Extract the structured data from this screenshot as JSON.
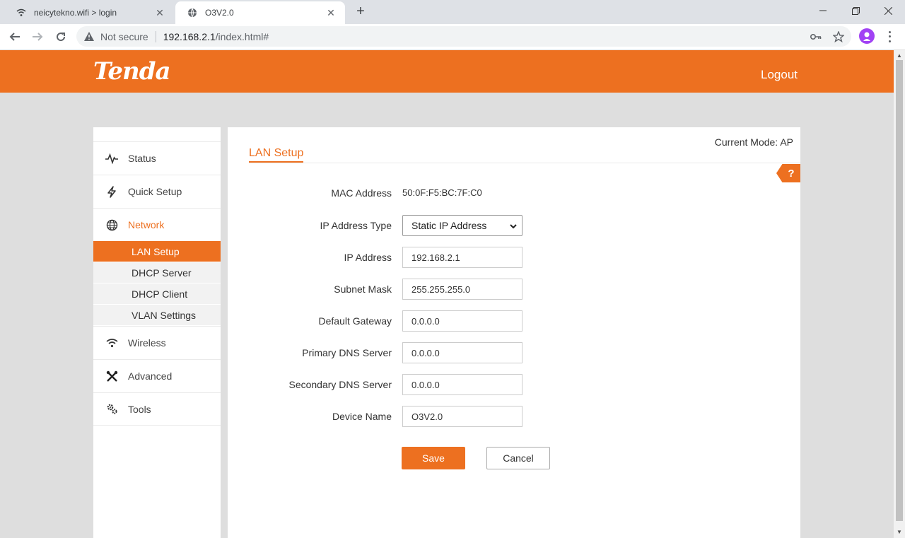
{
  "browser": {
    "tabs": [
      {
        "title": "neicytekno.wifi > login",
        "favicon": "wifi-icon"
      },
      {
        "title": "O3V2.0",
        "favicon": "globe-icon"
      }
    ],
    "new_tab": "+",
    "not_secure": "Not secure",
    "url_host": "192.168.2.1",
    "url_path": "/index.html#"
  },
  "header": {
    "logo": "Tenda",
    "logout": "Logout",
    "brand_color": "#ed7020"
  },
  "sidebar": {
    "items": [
      {
        "label": "Status",
        "icon": "pulse-icon"
      },
      {
        "label": "Quick Setup",
        "icon": "bolt-icon"
      },
      {
        "label": "Network",
        "icon": "globe-icon"
      },
      {
        "label": "Wireless",
        "icon": "wifi-icon"
      },
      {
        "label": "Advanced",
        "icon": "tools-icon"
      },
      {
        "label": "Tools",
        "icon": "gears-icon"
      }
    ],
    "network_sub": [
      "LAN Setup",
      "DHCP Server",
      "DHCP Client",
      "VLAN Settings"
    ]
  },
  "main": {
    "current_mode": "Current Mode: AP",
    "title": "LAN Setup",
    "help": "?",
    "fields": {
      "mac": {
        "label": "MAC Address",
        "value": "50:0F:F5:BC:7F:C0"
      },
      "ip_type": {
        "label": "IP Address Type",
        "value": "Static IP Address"
      },
      "ip": {
        "label": "IP Address",
        "value": "192.168.2.1"
      },
      "mask": {
        "label": "Subnet Mask",
        "value": "255.255.255.0"
      },
      "gateway": {
        "label": "Default Gateway",
        "value": "0.0.0.0"
      },
      "dns1": {
        "label": "Primary DNS Server",
        "value": "0.0.0.0"
      },
      "dns2": {
        "label": "Secondary DNS Server",
        "value": "0.0.0.0"
      },
      "device_name": {
        "label": "Device Name",
        "value": "O3V2.0"
      }
    },
    "save": "Save",
    "cancel": "Cancel"
  }
}
